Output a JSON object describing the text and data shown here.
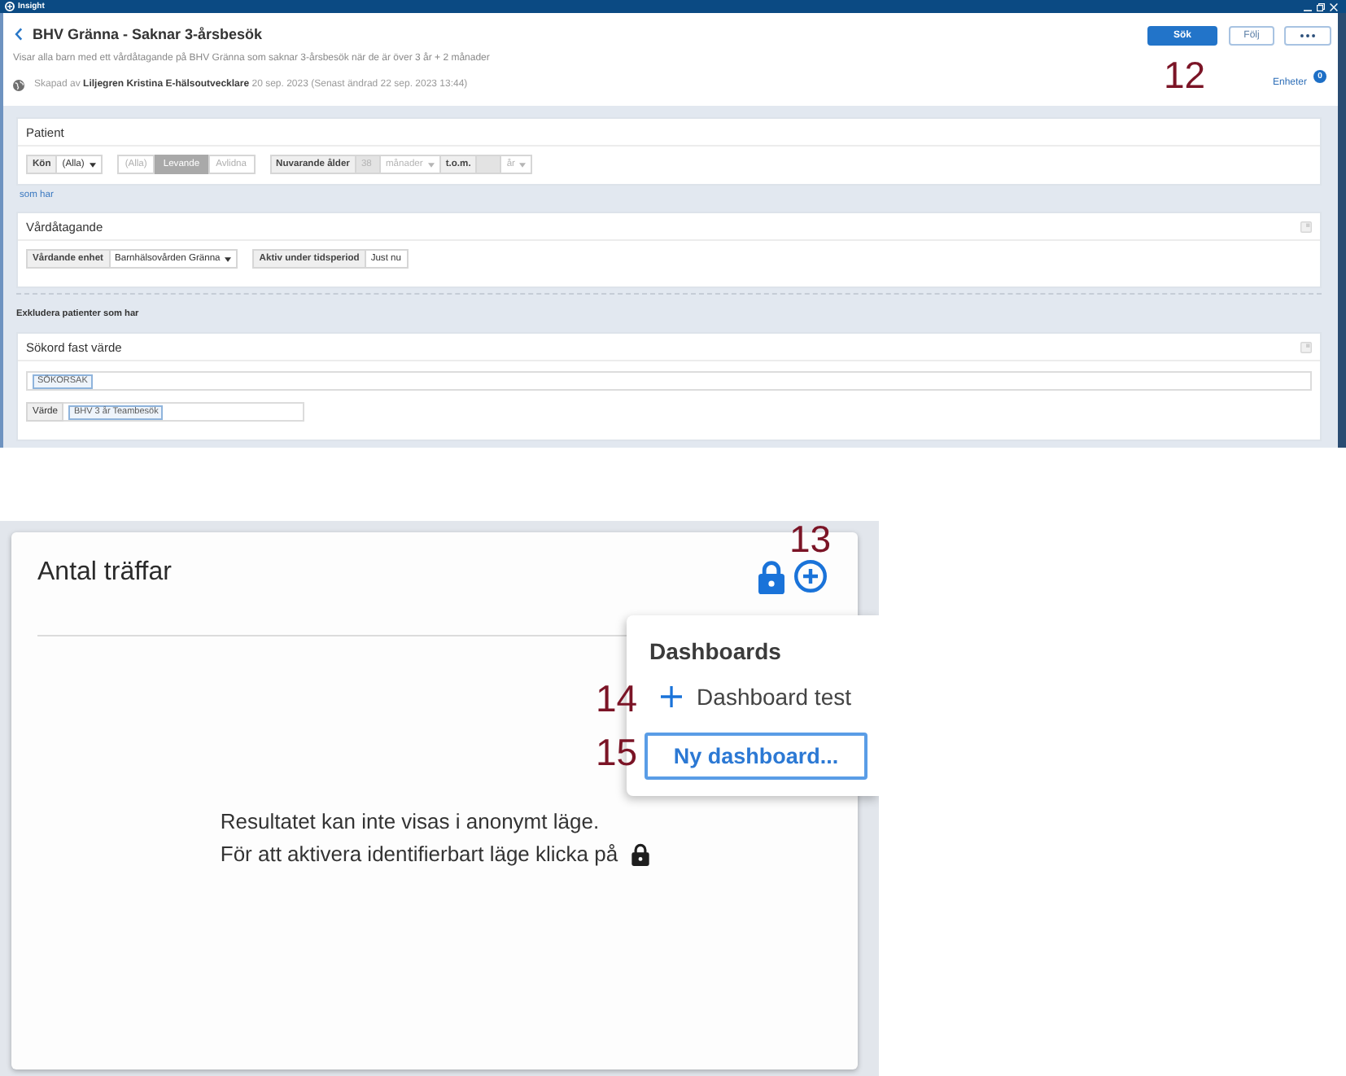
{
  "window": {
    "title": "Insight"
  },
  "header": {
    "title": "BHV Gränna - Saknar 3-årsbesök",
    "description": "Visar alla barn med ett vårdåtagande på BHV Gränna som saknar 3-årsbesök när de är över 3 år + 2 månader",
    "created": "Skapad av **Liljegren Kristina E-hälsoutvecklare** 20 sep. 2023 (Senast ändrad 22 sep. 2023 13:44)",
    "buttons": [
      {
        "kind": "primary",
        "label": "Sök"
      },
      {
        "kind": "secondary",
        "label": "Följ"
      },
      {
        "kind": "more"
      }
    ],
    "annotation": "12",
    "units_link": {
      "label": "Enheter",
      "badge": "0"
    }
  },
  "patient_card": {
    "title": "Patient",
    "filters": [
      {
        "kind": "dropdown",
        "label": "Kön",
        "value": "(Alla)"
      },
      {
        "kind": "segmented",
        "options": [
          {
            "label": "(Alla)",
            "selected": false
          },
          {
            "label": "Levande",
            "selected": true
          },
          {
            "label": "Avlidna",
            "selected": false
          }
        ]
      },
      {
        "kind": "age_range",
        "label": "Nuvarande ålder",
        "from": "38",
        "from_unit": "månader",
        "to_label": "t.o.m.",
        "to_unit": "år",
        "disabled": true
      }
    ]
  },
  "connector_link": "som har",
  "care_card": {
    "title": "Vårdåtagande",
    "filters": [
      {
        "kind": "dropdown",
        "label": "Vårdande enhet",
        "value": "Barnhälsovården Gränna"
      },
      {
        "kind": "static",
        "label": "Aktiv under tidsperiod",
        "value": "Just nu"
      }
    ]
  },
  "exclude_heading": "Exkludera patienter som har",
  "keyword_card": {
    "title": "Sökord fast värde",
    "keyword_tags": [
      "SÖKORSAK"
    ],
    "value_label": "Värde",
    "value_tags": [
      "BHV 3 år Teambesök"
    ]
  },
  "hits_card": {
    "title": "Antal träffar",
    "annotation": "13",
    "message": [
      "Resultatet kan inte visas i anonymt läge.",
      "För att aktivera identifierbart läge klicka på"
    ]
  },
  "dashboards_menu": {
    "title": "Dashboards",
    "items": [
      {
        "kind": "add",
        "label": "Dashboard test",
        "annotation": "14"
      }
    ],
    "new_button": {
      "label": "Ny dashboard...",
      "focused": true,
      "annotation": "15"
    }
  }
}
